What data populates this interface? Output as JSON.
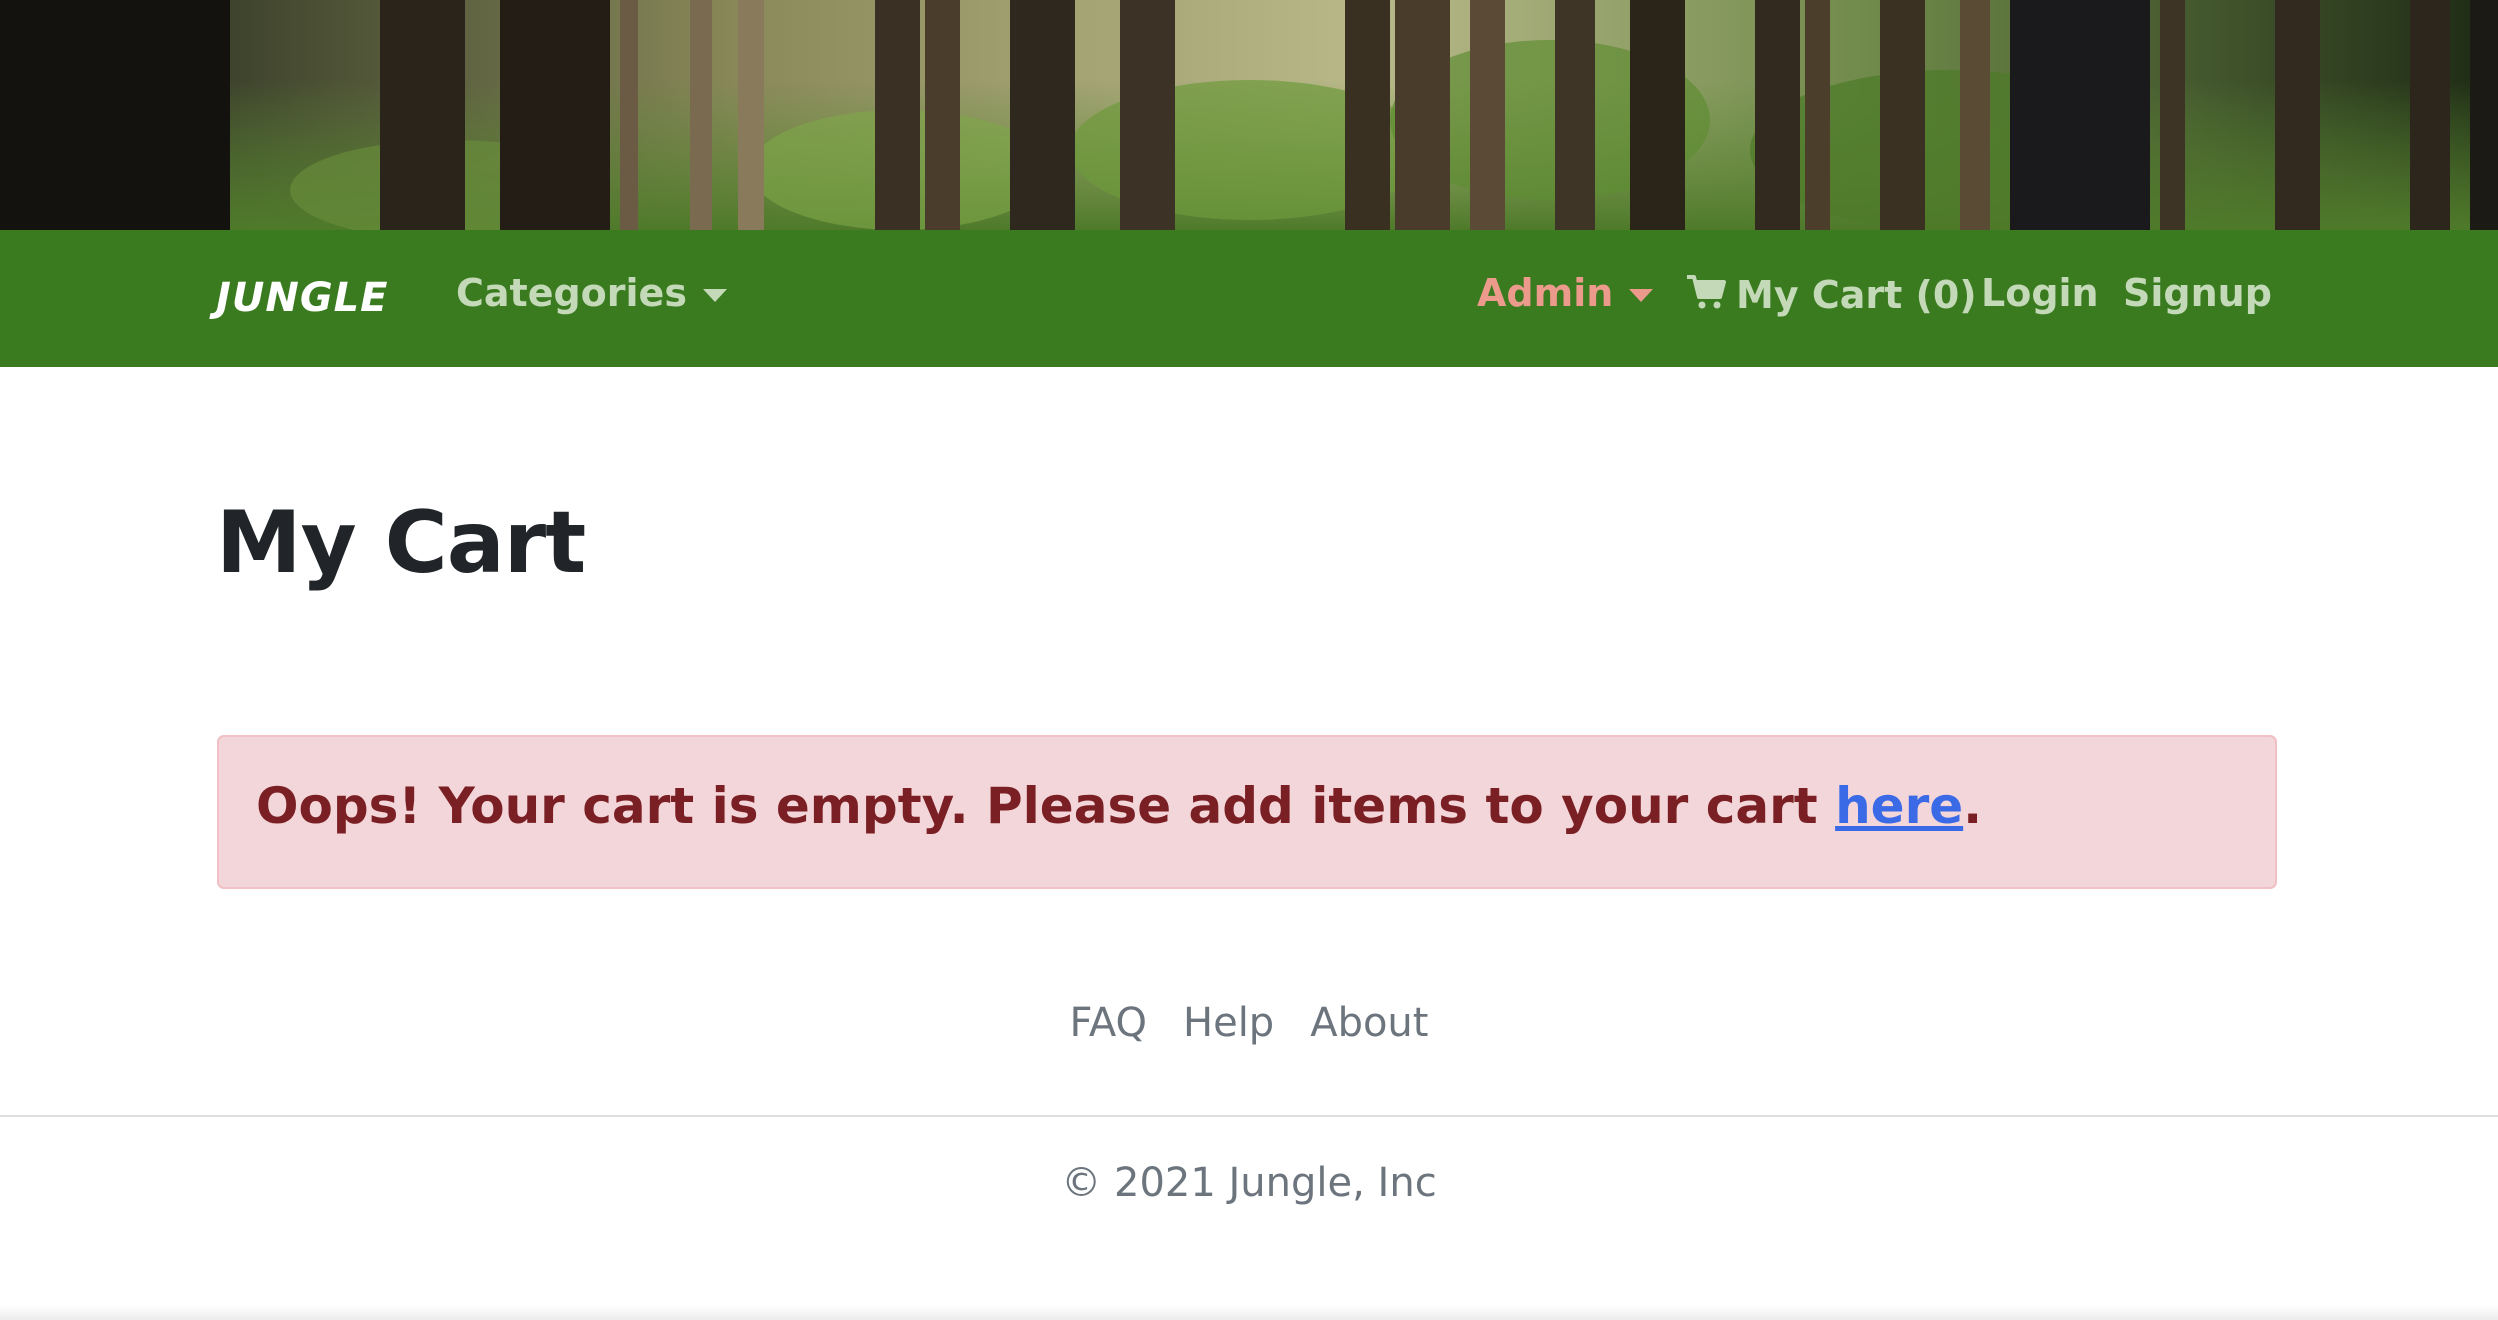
{
  "navbar": {
    "brand": "JUNGLE",
    "categories_label": "Categories",
    "admin_label": "Admin",
    "cart_label": "My Cart (0)",
    "login_label": "Login",
    "signup_label": "Signup",
    "icons": {
      "cart": "shopping-cart-icon",
      "dropdown": "caret-down-icon"
    }
  },
  "main": {
    "title": "My Cart",
    "alert": {
      "message": "Oops! Your cart is empty. Please add items to your cart ",
      "link_text": "here",
      "suffix": "."
    }
  },
  "footer": {
    "links": [
      "FAQ",
      "Help",
      "About"
    ],
    "copyright": "© 2021 Jungle, Inc"
  },
  "colors": {
    "navbar_bg": "#3a7b20",
    "nav_link": "#c4d9b8",
    "admin_link": "#ec9a8c",
    "alert_bg": "#f3d6d9",
    "alert_text": "#7a1f23",
    "link": "#3a6ae6",
    "muted": "#6c757d"
  }
}
